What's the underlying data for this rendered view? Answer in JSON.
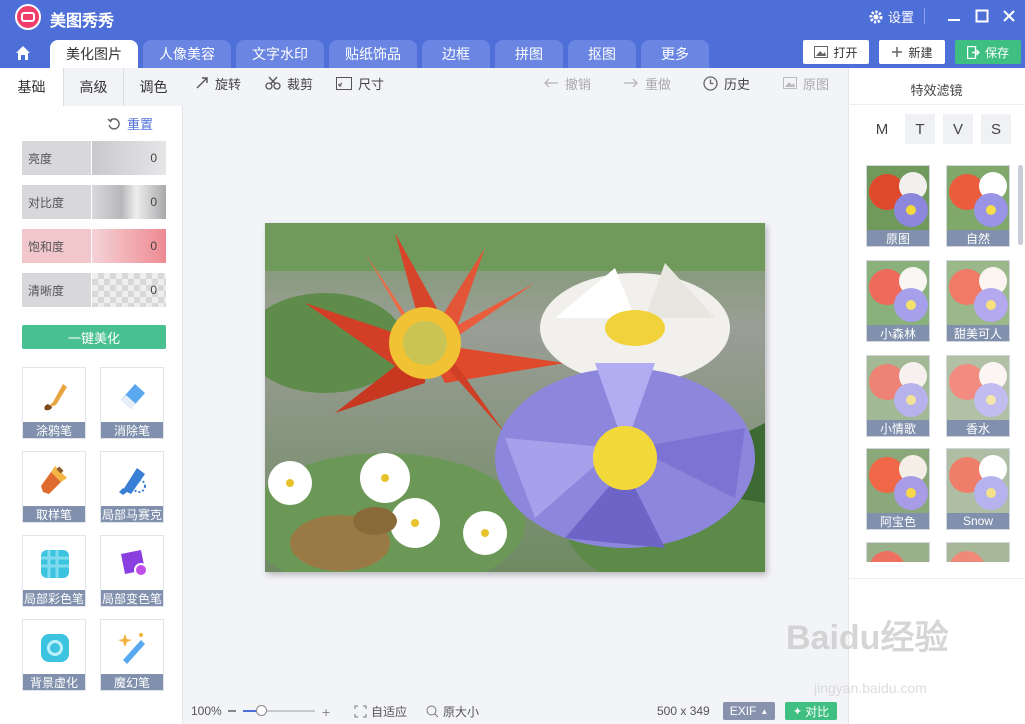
{
  "app": {
    "title": "美图秀秀",
    "settings": "设置"
  },
  "tabs": [
    "美化图片",
    "人像美容",
    "文字水印",
    "贴纸饰品",
    "边框",
    "拼图",
    "抠图",
    "更多"
  ],
  "top_buttons": {
    "open": "打开",
    "new": "新建",
    "save": "保存"
  },
  "left": {
    "subtabs": [
      "基础",
      "高级",
      "调色"
    ],
    "reset": "重置",
    "sliders": [
      {
        "label": "亮度",
        "value": "0"
      },
      {
        "label": "对比度",
        "value": "0"
      },
      {
        "label": "饱和度",
        "value": "0"
      },
      {
        "label": "清晰度",
        "value": "0"
      }
    ],
    "beautify": "一键美化",
    "tools": [
      "涂鸦笔",
      "消除笔",
      "取样笔",
      "局部马赛克",
      "局部彩色笔",
      "局部变色笔",
      "背景虚化",
      "魔幻笔"
    ]
  },
  "toolbar": {
    "rotate": "旋转",
    "crop": "裁剪",
    "size": "尺寸",
    "undo": "撤销",
    "redo": "重做",
    "history": "历史",
    "original": "原图"
  },
  "bottom": {
    "zoom": "100%",
    "fit": "自适应",
    "actual": "原大小",
    "dims": "500 x 349",
    "exif": "EXIF",
    "compare": "对比"
  },
  "right": {
    "title": "特效滤镜",
    "filter_tabs": [
      "M",
      "T",
      "V",
      "S"
    ],
    "filters": [
      "原图",
      "自然",
      "小森林",
      "甜美可人",
      "小情歌",
      "香水",
      "阿宝色",
      "Snow"
    ]
  },
  "watermark": {
    "brand": "Baidu经验",
    "url": "jingyan.baidu.com"
  },
  "colors": {
    "accent": "#4f6fd8",
    "green": "#3fbf82"
  }
}
